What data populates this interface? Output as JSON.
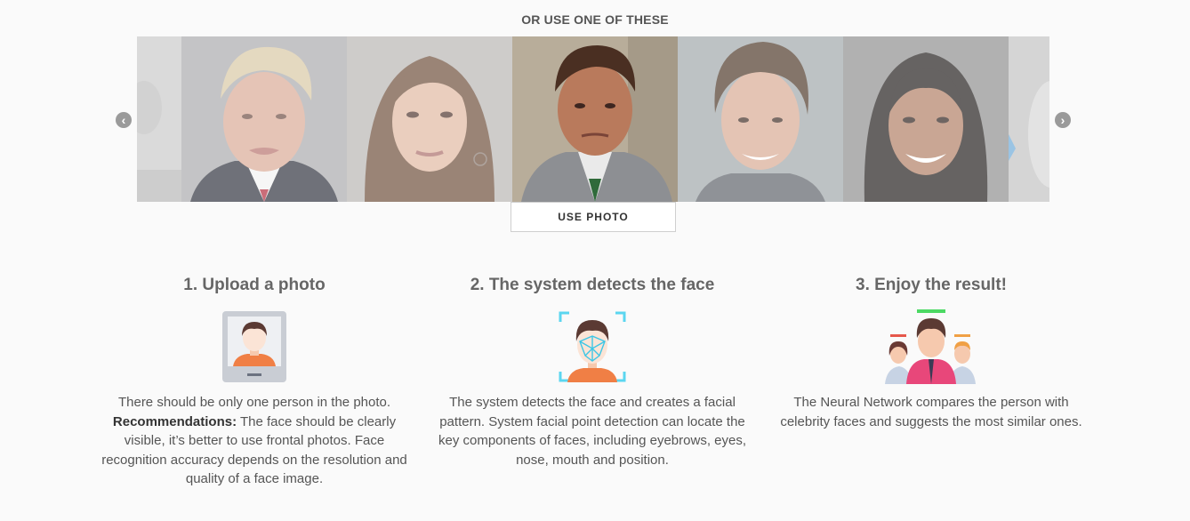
{
  "gallery": {
    "heading": "OR USE ONE OF THESE",
    "photos": [
      {
        "name": "person-1",
        "active": false
      },
      {
        "name": "person-2",
        "active": false
      },
      {
        "name": "person-3",
        "active": false
      },
      {
        "name": "person-4",
        "active": true
      },
      {
        "name": "person-5",
        "active": false
      },
      {
        "name": "person-6",
        "active": false
      },
      {
        "name": "person-7",
        "active": false
      }
    ],
    "prev_icon": "chevron-left-icon",
    "next_icon": "chevron-right-icon",
    "use_photo_label": "USE PHOTO"
  },
  "steps": [
    {
      "title": "1. Upload a photo",
      "icon": "upload-photo-icon",
      "text_lead": "There should be only one person in the photo.",
      "text_bold": "Recommendations:",
      "text_rest": " The face should be clearly visible, it’s better to use frontal photos. Face recognition accuracy depends on the resolution and quality of a face image."
    },
    {
      "title": "2. The system detects the face",
      "icon": "face-detection-icon",
      "text": "The system detects the face and creates a facial pattern. System facial point detection can locate the key components of faces, including eyebrows, eyes, nose, mouth and position."
    },
    {
      "title": "3. Enjoy the result!",
      "icon": "people-match-icon",
      "text": "The Neural Network compares the person with celebrity faces and suggests the most similar ones."
    }
  ]
}
